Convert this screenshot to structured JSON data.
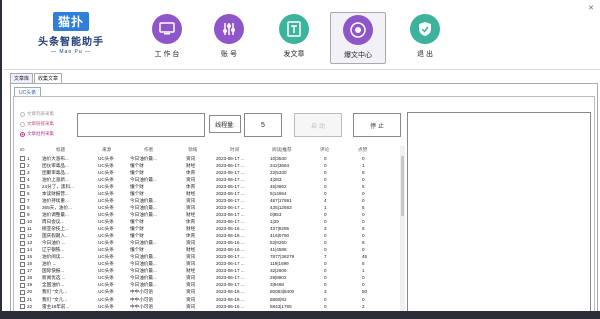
{
  "app": {
    "logo_mark": "猫扑",
    "logo_brand": "头条智能助手",
    "logo_sub": "— Mao Pu —",
    "close_glyph": "✕"
  },
  "nav": [
    {
      "label": "工 作 台",
      "icon": "desktop-icon",
      "color": "#8e56c9"
    },
    {
      "label": "账 号",
      "icon": "sliders-icon",
      "color": "#8e56c9"
    },
    {
      "label": "发文章",
      "icon": "document-icon",
      "color": "#3db39e"
    },
    {
      "label": "爆文中心",
      "icon": "target-icon",
      "color": "#8e56c9"
    },
    {
      "label": "退 出",
      "icon": "shield-check-icon",
      "color": "#3db39e"
    }
  ],
  "outer_tabs": [
    "文章库",
    "收集文章"
  ],
  "inner_tab": "UC头条",
  "radios": [
    "文章列表采集",
    "文章链接采集",
    "文章批判采集"
  ],
  "thread": {
    "label": "线程量:",
    "value": "5"
  },
  "buttons": {
    "start": "启 动",
    "stop": "停 止"
  },
  "columns": [
    "ID",
    "标题",
    "来源",
    "作者",
    "领域",
    "时间",
    "阅读|推荐",
    "评论",
    "点赞"
  ],
  "rows": [
    [
      "1",
      "油价大涨布...",
      "UC头条",
      "今日油价最...",
      "资讯",
      "2023-06-17 ...",
      "10|3530",
      "0",
      "0"
    ],
    [
      "2",
      "团伙审毒品...",
      "UC头条",
      "懂个财",
      "财经",
      "2023-06-17 ...",
      "242|3684",
      "0",
      "1"
    ],
    [
      "3",
      "团聚审毒品...",
      "UC头条",
      "懂个财",
      "体育",
      "2023-06-17 ...",
      "22|5330",
      "0",
      "8"
    ],
    [
      "4",
      "油价上涨新...",
      "UC头条",
      "今日油价最...",
      "资讯",
      "2023-06-17 ...",
      "4|283",
      "0",
      "0"
    ],
    [
      "5",
      "24分了，黑科...",
      "UC头条",
      "懂个财",
      "体育",
      "2023-06-17 ...",
      "45|3862",
      "0",
      "5"
    ],
    [
      "6",
      "本读财报营...",
      "UC头条",
      "懂个财",
      "财经",
      "2023-06-17 ...",
      "5|14664",
      "0",
      "0"
    ],
    [
      "7",
      "油价持续重...",
      "UC头条",
      "今日油价最...",
      "资讯",
      "2023-06-17 ...",
      "487|17891",
      "4",
      "0"
    ],
    [
      "8",
      "365天，油价...",
      "UC头条",
      "今日油价最...",
      "资讯",
      "2023-06-17 ...",
      "435|12683",
      "1",
      "5"
    ],
    [
      "9",
      "油价调整最...",
      "UC头条",
      "今日油价最...",
      "财经",
      "2023-06-17 ...",
      "0|853",
      "0",
      "0"
    ],
    [
      "10",
      "周日会议...",
      "UC头条",
      "懂个财",
      "体育",
      "2023-06-17 ...",
      "1|29",
      "0",
      "0"
    ],
    [
      "11",
      "挪亚杂技上...",
      "UC头条",
      "懂个财",
      "财经",
      "2023-06-16 ...",
      "437|8285",
      "3",
      "6"
    ],
    [
      "12",
      "国庆假期入...",
      "UC头条",
      "懂个财",
      "体育",
      "2023-06-16 ...",
      "416|5790",
      "0",
      "0"
    ],
    [
      "13",
      "今日油价 ...",
      "UC头条",
      "今日油价最...",
      "资讯",
      "2023-06-16 ...",
      "52|8250",
      "0",
      "8"
    ],
    [
      "14",
      "辽宁钢铁...",
      "UC头条",
      "懂个财",
      "财经",
      "2023-06-16 ...",
      "41|4588",
      "0",
      "0"
    ],
    [
      "15",
      "油价阅读...",
      "UC头条",
      "今日油价最...",
      "资讯",
      "2023-06-17 ...",
      "7877|38279",
      "7",
      "45"
    ],
    [
      "16",
      "油价 ...",
      "UC头条",
      "今日油价最...",
      "资讯",
      "2023-06-17 ...",
      "119|1699",
      "0",
      "6"
    ],
    [
      "17",
      "国际快报...",
      "UC头条",
      "今日油价最...",
      "财经",
      "2023-06-17 ...",
      "32|2606",
      "0",
      "1"
    ],
    [
      "18",
      "新闻优选 ...",
      "UC头条",
      "今日油价最...",
      "资讯",
      "2023-06-17 ...",
      "29|8802",
      "0",
      "0"
    ],
    [
      "19",
      "全国油价...",
      "UC头条",
      "今日油价最...",
      "资讯",
      "2023-06-17 ...",
      "3|9468",
      "0",
      "0"
    ],
    [
      "20",
      "我们 \"文儿...",
      "UC头条",
      "中中小可语",
      "资讯",
      "2023-06-16 ...",
      "80063|8400",
      "3",
      "50"
    ],
    [
      "21",
      "我们 \"文儿...",
      "UC头条",
      "中中小可语",
      "资讯",
      "2023-06-16 ...",
      "5860|82",
      "0",
      "0"
    ],
    [
      "22",
      "雷主19年前...",
      "UC头条",
      "中中小可语",
      "资讯",
      "2023-06-16 ...",
      "5843|1765",
      "0",
      "2"
    ],
    [
      "23",
      "我们的 ...",
      "UC头条",
      "中中小可语",
      "资讯",
      "2023-06-16 ...",
      "3810|2402",
      "0",
      "0"
    ]
  ]
}
